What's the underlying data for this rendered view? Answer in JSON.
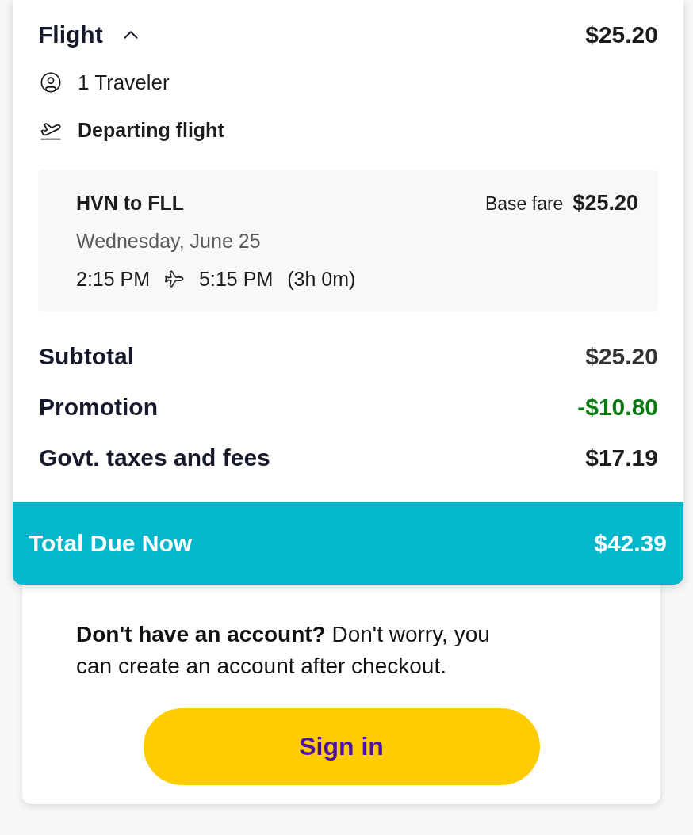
{
  "summary": {
    "section": {
      "title": "Flight",
      "expanded": true,
      "price": "$25.20"
    },
    "travelers": "1 Traveler",
    "departing_label": "Departing flight",
    "segment": {
      "route": "HVN to FLL",
      "fare_label": "Base fare",
      "fare": "$25.20",
      "date": "Wednesday, June 25",
      "depart_time": "2:15 PM",
      "arrive_time": "5:15 PM",
      "duration": "(3h 0m)"
    },
    "lines": [
      {
        "label": "Subtotal",
        "value": "$25.20",
        "kind": "subtotal"
      },
      {
        "label": "Promotion",
        "value": "-$10.80",
        "kind": "discount"
      },
      {
        "label": "Govt. taxes and fees",
        "value": "$17.19",
        "kind": "charge"
      }
    ],
    "total": {
      "label": "Total Due Now",
      "value": "$42.39"
    }
  },
  "account": {
    "message": "**Don't have an account?** Don't worry, you can create an account after checkout.",
    "button": "Sign in"
  }
}
